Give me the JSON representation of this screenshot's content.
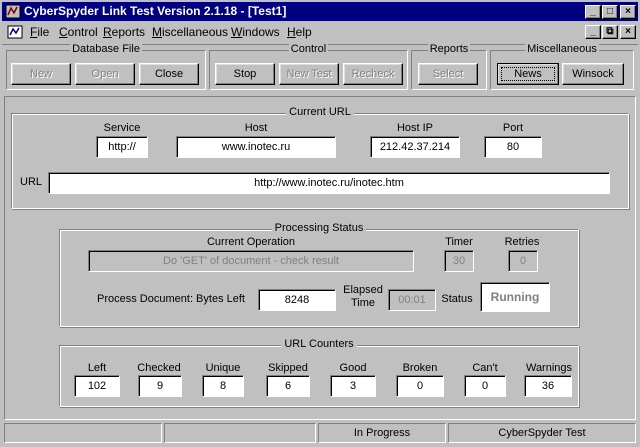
{
  "window": {
    "title": "CyberSpyder Link Test Version 2.1.18 - [Test1]",
    "buttons": {
      "minimize": "_",
      "maximize": "□",
      "close": "×"
    },
    "mdi_buttons": {
      "minimize": "_",
      "restore": "⧉",
      "close": "×"
    }
  },
  "menu": {
    "items": [
      {
        "underline": "F",
        "rest": "ile"
      },
      {
        "underline": "C",
        "rest": "ontrol"
      },
      {
        "underline": "R",
        "rest": "eports"
      },
      {
        "underline": "M",
        "rest": "iscellaneous"
      },
      {
        "underline": "W",
        "rest": "indows"
      },
      {
        "underline": "H",
        "rest": "elp"
      }
    ]
  },
  "toolbar": {
    "database_file": {
      "label": "Database File",
      "new": "New",
      "open": "Open",
      "close": "Close"
    },
    "control": {
      "label": "Control",
      "stop": "Stop",
      "new_test": "New Test",
      "recheck": "Recheck"
    },
    "reports": {
      "label": "Reports",
      "select": "Select"
    },
    "misc": {
      "label": "Miscellaneous",
      "news": "News",
      "winsock": "Winsock"
    }
  },
  "current_url": {
    "title": "Current URL",
    "service_label": "Service",
    "service": "http://",
    "host_label": "Host",
    "host": "www.inotec.ru",
    "hostip_label": "Host IP",
    "hostip": "212.42.37.214",
    "port_label": "Port",
    "port": "80",
    "url_label": "URL",
    "url": "http://www.inotec.ru/inotec.htm"
  },
  "processing": {
    "title": "Processing Status",
    "current_op_label": "Current Operation",
    "current_op": "Do 'GET' of document - check result",
    "timer_label": "Timer",
    "timer": "30",
    "retries_label": "Retries",
    "retries": "0",
    "bytes_left_label": "Process Document: Bytes Left",
    "bytes_left": "8248",
    "elapsed_label_1": "Elapsed",
    "elapsed_label_2": "Time",
    "elapsed": "00:01",
    "status_label": "Status",
    "status": "Running"
  },
  "counters": {
    "title": "URL Counters",
    "items": [
      {
        "label": "Left",
        "value": "102"
      },
      {
        "label": "Checked",
        "value": "9"
      },
      {
        "label": "Unique",
        "value": "8"
      },
      {
        "label": "Skipped",
        "value": "6"
      },
      {
        "label": "Good",
        "value": "3"
      },
      {
        "label": "Broken",
        "value": "0"
      },
      {
        "label": "Can't",
        "value": "0"
      },
      {
        "label": "Warnings",
        "value": "36"
      }
    ]
  },
  "statusbar": {
    "panel1": "",
    "panel2": "",
    "panel3": "In Progress",
    "panel4": "CyberSpyder Test"
  }
}
